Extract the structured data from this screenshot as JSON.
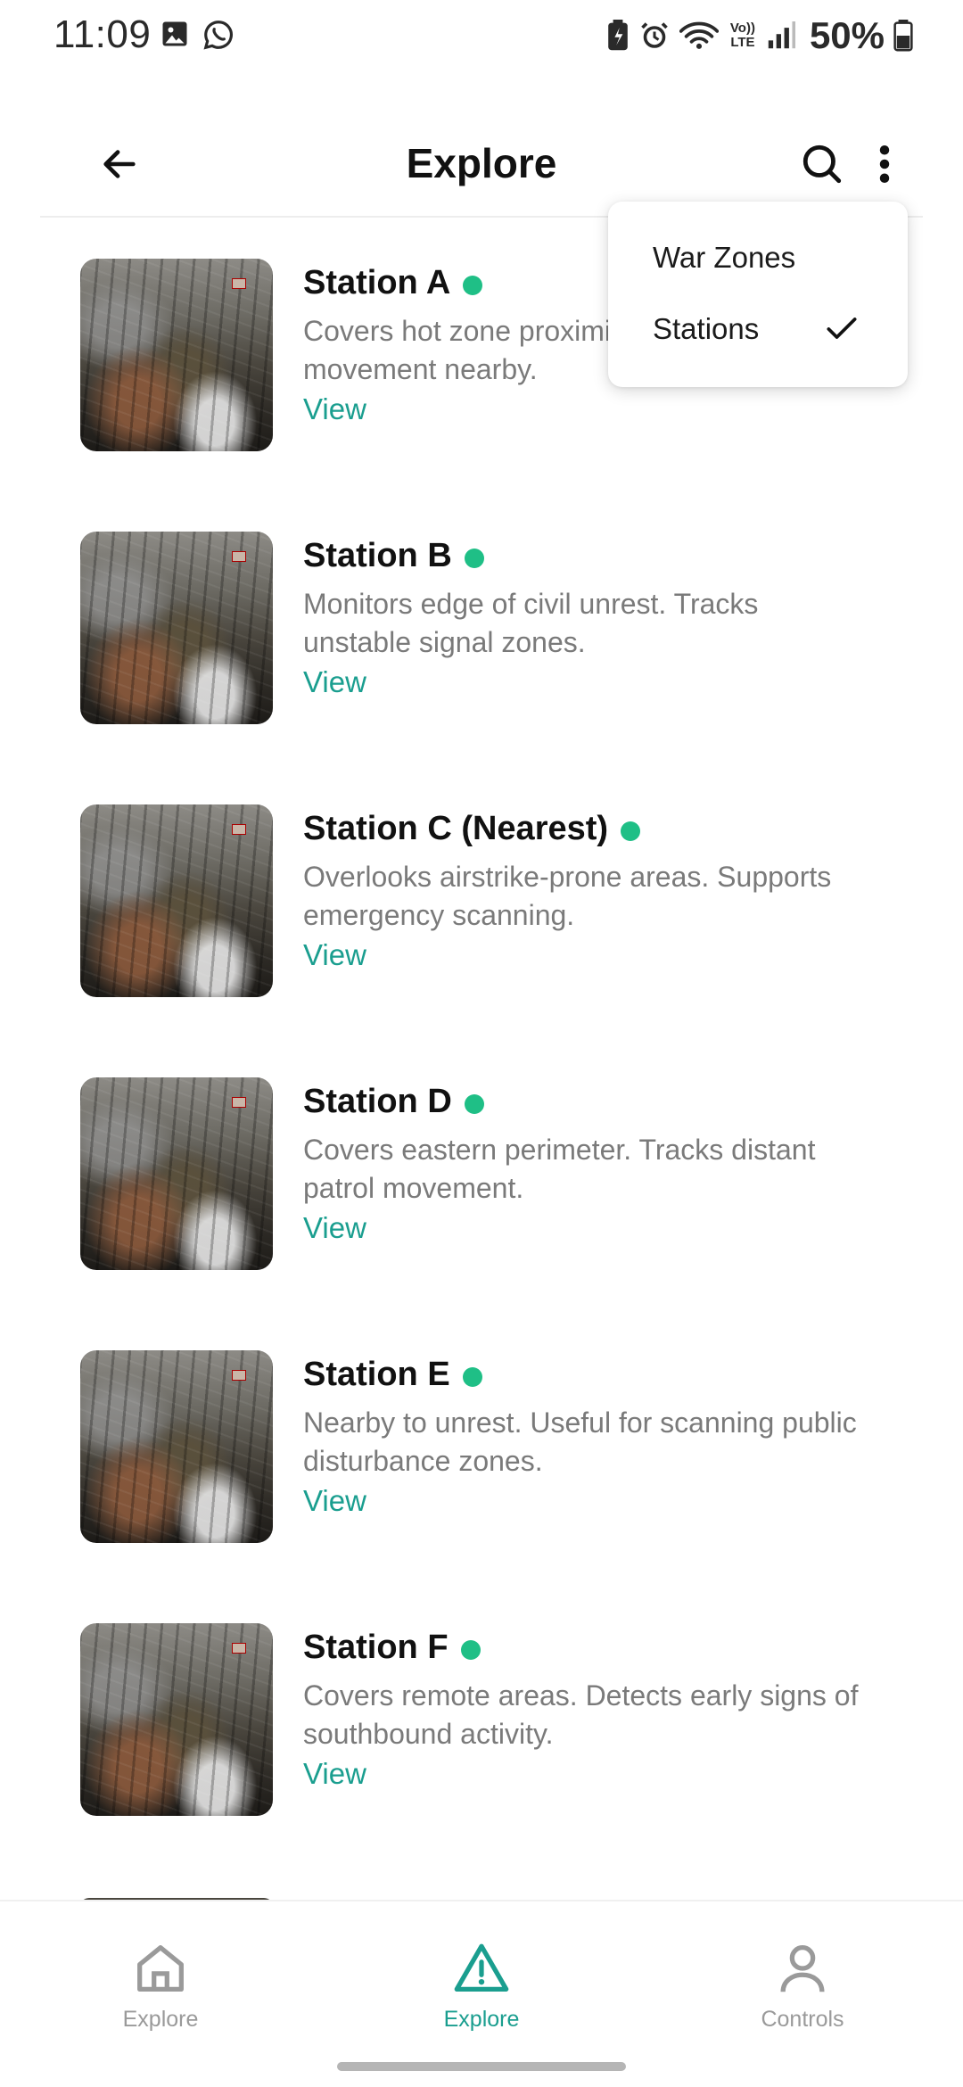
{
  "status_bar": {
    "time": "11:09",
    "left_icons": [
      "gallery-icon",
      "whatsapp-icon"
    ],
    "right_icons": [
      "battery-saver-icon",
      "alarm-icon",
      "wifi-icon",
      "volte-icon",
      "signal-icon",
      "battery-icon"
    ],
    "volte_label": "Vo)) LTE",
    "battery_percent": "50%"
  },
  "app_bar": {
    "title": "Explore",
    "back_icon": "arrow-left-icon",
    "search_icon": "search-icon",
    "more_icon": "more-vertical-icon"
  },
  "menu": {
    "items": [
      {
        "label": "War Zones",
        "checked": false
      },
      {
        "label": "Stations",
        "checked": true
      }
    ]
  },
  "stations": [
    {
      "name": "Station A",
      "description": "Covers hot zone proximity. Tracks artillery movement nearby.",
      "view_label": "View",
      "status_color": "#1fbf86"
    },
    {
      "name": "Station B",
      "description": "Monitors edge of civil unrest. Tracks unstable signal zones.",
      "view_label": "View",
      "status_color": "#1fbf86"
    },
    {
      "name": "Station C (Nearest)",
      "description": "Overlooks airstrike-prone areas. Supports emergency scanning.",
      "view_label": "View",
      "status_color": "#1fbf86"
    },
    {
      "name": "Station D",
      "description": "Covers eastern perimeter. Tracks distant patrol movement.",
      "view_label": "View",
      "status_color": "#1fbf86"
    },
    {
      "name": "Station E",
      "description": "Nearby to unrest. Useful for scanning public disturbance zones.",
      "view_label": "View",
      "status_color": "#1fbf86"
    },
    {
      "name": "Station F",
      "description": "Covers remote areas. Detects early signs of southbound activity.",
      "view_label": "View",
      "status_color": "#1fbf86"
    }
  ],
  "bottom_nav": {
    "items": [
      {
        "label": "Explore",
        "icon": "home-icon",
        "active": false
      },
      {
        "label": "Explore",
        "icon": "warning-icon",
        "active": true
      },
      {
        "label": "Controls",
        "icon": "user-icon",
        "active": false
      }
    ]
  },
  "colors": {
    "accent": "#1a9e8f",
    "status_online": "#1fbf86",
    "muted_text": "#7a7a7a"
  }
}
